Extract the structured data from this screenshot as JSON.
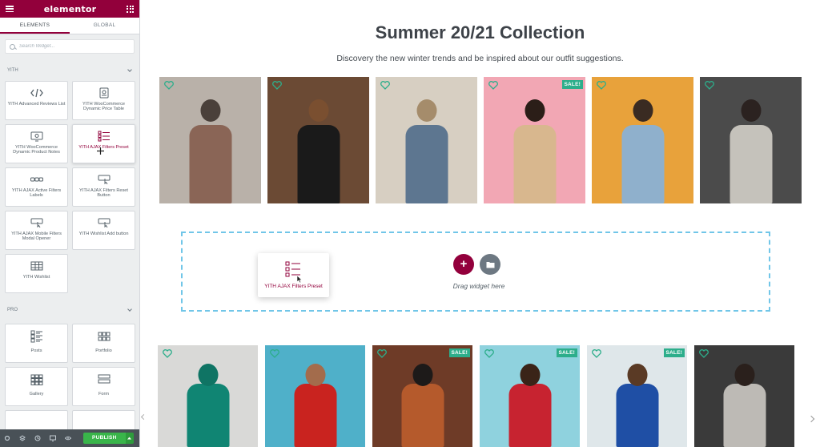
{
  "app": {
    "brand": "elementor",
    "colors": {
      "brand": "#92003b",
      "accent": "#39b54a",
      "sale": "#2dae8b",
      "dropzone_border": "#71c6e8"
    }
  },
  "sidebar": {
    "tabs": [
      {
        "label": "ELEMENTS",
        "active": true
      },
      {
        "label": "GLOBAL",
        "active": false
      }
    ],
    "search": {
      "placeholder": "Search Widget..."
    },
    "sections": [
      {
        "title": "YITH",
        "widgets": [
          {
            "label": "YITH Advanced Reviews List",
            "icon": "code-icon"
          },
          {
            "label": "YITH WooCommerce Dynamic Price Table",
            "icon": "price-table-icon"
          },
          {
            "label": "YITH WooCommerce Dynamic Product Notes",
            "icon": "note-icon"
          },
          {
            "label": "YITH AJAX Filters Preset",
            "icon": "filter-list-icon"
          },
          {
            "label": "YITH AJAX Active Filters Labels",
            "icon": "labels-icon"
          },
          {
            "label": "YITH AJAX Filters Reset Button",
            "icon": "reset-button-icon"
          },
          {
            "label": "YITH AJAX Mobile Filters Modal Opener",
            "icon": "modal-button-icon"
          },
          {
            "label": "YITH Wishlist Add button",
            "icon": "wishlist-button-icon"
          },
          {
            "label": "YITH Wishlist",
            "icon": "table-icon"
          }
        ]
      },
      {
        "title": "PRO",
        "widgets": [
          {
            "label": "Posts",
            "icon": "posts-icon"
          },
          {
            "label": "Portfolio",
            "icon": "portfolio-icon"
          },
          {
            "label": "Gallery",
            "icon": "gallery-icon"
          },
          {
            "label": "Form",
            "icon": "form-icon"
          }
        ]
      }
    ],
    "bottom": {
      "publish_label": "PUBLISH"
    }
  },
  "main": {
    "title": "Summer 20/21 Collection",
    "subtitle": "Discovery the new winter trends and be inspired about our outfit suggestions.",
    "sale_label": "SALE!",
    "dropzone": {
      "hint": "Drag widget here",
      "add": "+"
    },
    "dragged_widget": {
      "label": "YITH AJAX Filters Preset"
    },
    "products_row1": [
      {
        "name": "man-in-doorway-photo",
        "bg": "#b9b1a9",
        "top": "#4a403a",
        "body": "#8a6556",
        "sale": false
      },
      {
        "name": "woman-sunglasses-photo",
        "bg": "#6b4a34",
        "top": "#7a4f30",
        "body": "#1a1a1a",
        "sale": false
      },
      {
        "name": "woman-hat-denim-photo",
        "bg": "#d7cfc2",
        "top": "#a58c6b",
        "body": "#5d7690",
        "sale": false
      },
      {
        "name": "woman-jumping-pink-photo",
        "bg": "#f2a7b4",
        "top": "#2b1e18",
        "body": "#d8b78e",
        "sale": true
      },
      {
        "name": "man-yellow-wall-photo",
        "bg": "#e8a23b",
        "top": "#3a2b22",
        "body": "#8fb0cc",
        "sale": false
      },
      {
        "name": "woman-sweater-photo",
        "bg": "#4b4b4b",
        "top": "#2b2220",
        "body": "#c5c2bb",
        "sale": false
      }
    ],
    "products_row2": [
      {
        "name": "green-handbag-photo",
        "bg": "#d9d9d7",
        "top": "#0f7464",
        "body": "#108573",
        "sale": false
      },
      {
        "name": "man-red-sweater-photo",
        "bg": "#4fb0c9",
        "top": "#a36c4c",
        "body": "#c9231f",
        "sale": false
      },
      {
        "name": "woman-black-hat-photo",
        "bg": "#6e3b27",
        "top": "#1d1a19",
        "body": "#b55a2c",
        "sale": true
      },
      {
        "name": "man-jumping-sky-photo",
        "bg": "#8fd2de",
        "top": "#3a2418",
        "body": "#c72330",
        "sale": true
      },
      {
        "name": "woman-blue-dress-photo",
        "bg": "#dfe7ea",
        "top": "#5a3a25",
        "body": "#1f4fa5",
        "sale": true
      },
      {
        "name": "woman-grey-sweater-photo",
        "bg": "#3a3a3a",
        "top": "#2a201c",
        "body": "#bdbab5",
        "sale": false
      }
    ]
  }
}
